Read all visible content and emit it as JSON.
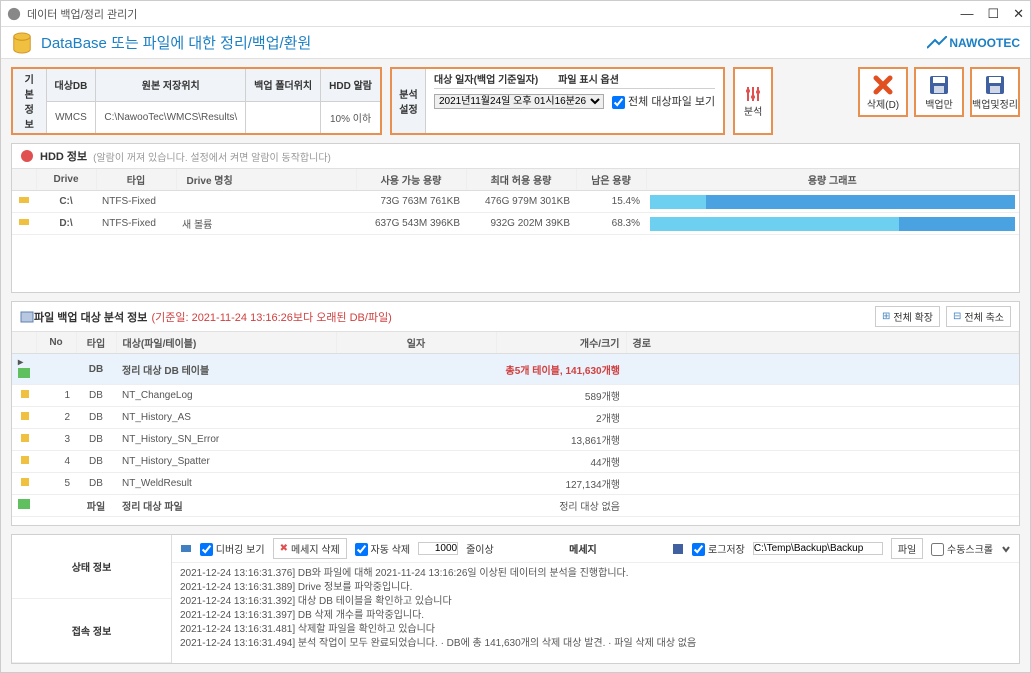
{
  "window": {
    "title": "데이터 백업/정리 관리기"
  },
  "header": {
    "title": "DataBase 또는 파일에 대한 정리/백업/환원",
    "logo": "NAWOOTEC"
  },
  "basic_info": {
    "label": "기본\n정보",
    "cols": [
      "대상DB",
      "원본 저장위치",
      "백업 폴더위치",
      "HDD 알람"
    ],
    "vals": [
      "WMCS",
      "C:\\NawooTec\\WMCS\\Results\\",
      "",
      "10% 이하"
    ]
  },
  "analyze": {
    "label": "분석\n설정",
    "cols": [
      "대상 일자(백업 기준일자)",
      "파일 표시 옵션"
    ],
    "date": "2021년11월24일 오후 01시16분26",
    "checkbox": "전체 대상파일 보기",
    "button": "분석"
  },
  "actions": {
    "delete": "삭제(D)",
    "backup_only": "백업만",
    "backup_clean": "백업및정리"
  },
  "hdd": {
    "title": "HDD 정보",
    "hint": "(알람이 꺼져 있습니다. 설정에서 켜면 알람이 동작합니다)",
    "cols": [
      "Drive",
      "타입",
      "Drive 명칭",
      "사용 가능 용량",
      "최대 허용 용량",
      "남은 용량",
      "용량 그래프"
    ],
    "rows": [
      {
        "drive": "C:\\",
        "type": "NTFS-Fixed",
        "name": "",
        "avail": "73G 763M 761KB",
        "max": "476G 979M 301KB",
        "remain": "15.4%",
        "used_pct": 84.6
      },
      {
        "drive": "D:\\",
        "type": "NTFS-Fixed",
        "name": "새 볼륨",
        "avail": "637G 543M 396KB",
        "max": "932G 202M 39KB",
        "remain": "68.3%",
        "used_pct": 31.7
      }
    ]
  },
  "file_info": {
    "title": "파일 백업 대상 분석 정보",
    "subtitle": "(기준일: 2021-11-24 13:16:26보다 오래된 DB/파일)",
    "expand_all": "전체 확장",
    "collapse_all": "전체 축소",
    "cols": [
      "No",
      "타입",
      "대상(파일/테이블)",
      "일자",
      "개수/크기",
      "경로"
    ],
    "summary_row": {
      "type": "DB",
      "target": "정리 대상 DB 테이블",
      "count": "총5개 테이블, 141,630개행"
    },
    "rows": [
      {
        "no": "1",
        "type": "DB",
        "target": "NT_ChangeLog",
        "count": "589개행"
      },
      {
        "no": "2",
        "type": "DB",
        "target": "NT_History_AS",
        "count": "2개행"
      },
      {
        "no": "3",
        "type": "DB",
        "target": "NT_History_SN_Error",
        "count": "13,861개행"
      },
      {
        "no": "4",
        "type": "DB",
        "target": "NT_History_Spatter",
        "count": "44개행"
      },
      {
        "no": "5",
        "type": "DB",
        "target": "NT_WeldResult",
        "count": "127,134개행"
      }
    ],
    "footer_row": {
      "type": "파일",
      "target": "정리 대상 파일",
      "count": "정리 대상 없음"
    }
  },
  "status": {
    "left_labels": [
      "상태 정보",
      "접속 정보"
    ],
    "toolbar": {
      "debug": "디버깅 보기",
      "msg_delete": "메세지 삭제",
      "auto_delete": "자동 삭제",
      "threshold": "1000",
      "threshold_label": "줄이상",
      "center": "메세지",
      "log_save": "로그저장",
      "log_path": "C:\\Temp\\Backup\\Backup",
      "file_btn": "파일",
      "auto_scroll": "수동스크롤"
    },
    "log": [
      "2021-12-24 13:16:31.376] DB와 파일에 대해 2021-11-24 13:16:26일 이상된 데이터의 분석을 진행합니다.",
      "2021-12-24 13:16:31.389] Drive 정보를 파악중입니다.",
      "2021-12-24 13:16:31.392] 대상 DB 테이블을 확인하고 있습니다",
      "2021-12-24 13:16:31.397] DB 삭제 개수를 파악중입니다.",
      "2021-12-24 13:16:31.481] 삭제할 파일을 확인하고 있습니다",
      "2021-12-24 13:16:31.494] 분석 작업이 모두 완료되었습니다. · DB에 총 141,630개의 삭제 대상 발견. · 파일 삭제 대상 없음"
    ]
  }
}
